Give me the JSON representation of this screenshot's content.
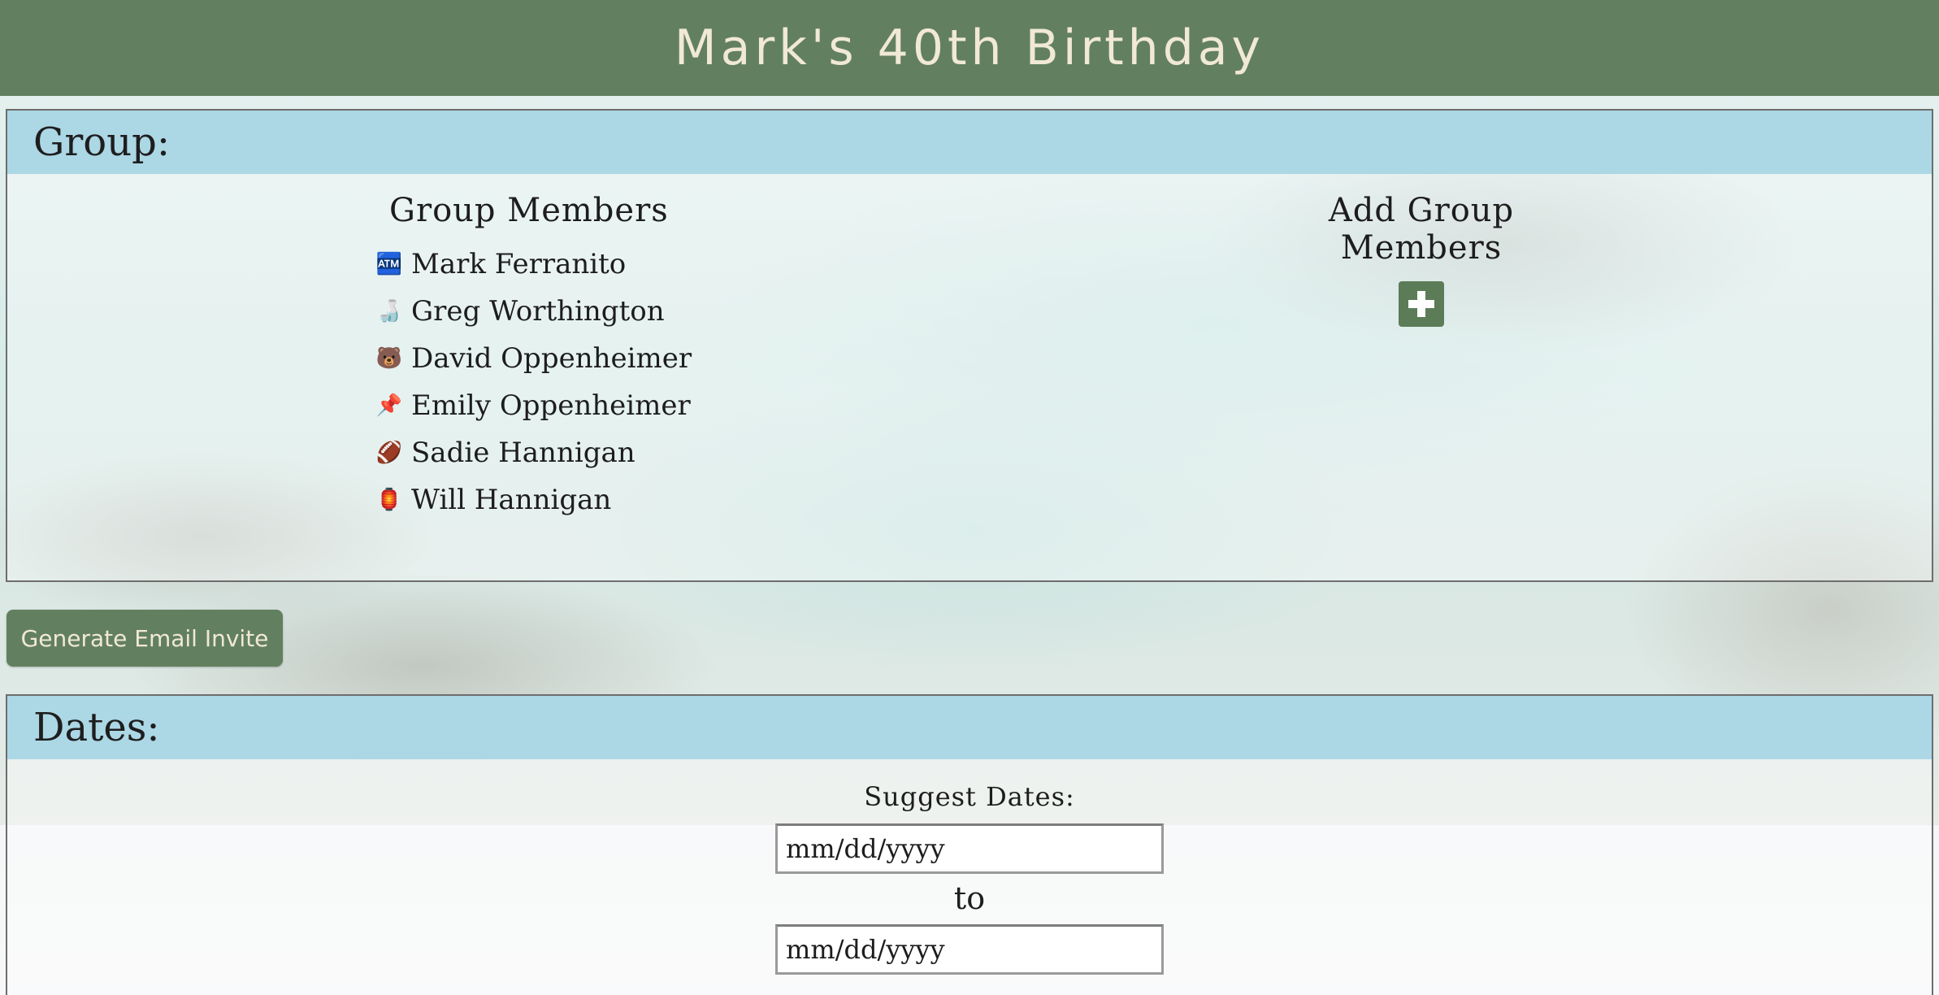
{
  "header": {
    "title": "Mark's 40th Birthday"
  },
  "group_section": {
    "title": "Group:",
    "members_heading": "Group Members",
    "members": [
      {
        "icon": "🏧",
        "icon_name": "atm-icon",
        "name": "Mark Ferranito"
      },
      {
        "icon": "🍶",
        "icon_name": "sake-bottle-icon",
        "name": "Greg Worthington"
      },
      {
        "icon": "🐻",
        "icon_name": "bear-icon",
        "name": "David Oppenheimer"
      },
      {
        "icon": "📌",
        "icon_name": "pushpin-icon",
        "name": "Emily Oppenheimer"
      },
      {
        "icon": "🏈",
        "icon_name": "football-icon",
        "name": "Sadie Hannigan"
      },
      {
        "icon": "🏮",
        "icon_name": "lantern-icon",
        "name": "Will Hannigan"
      }
    ],
    "add_heading": "Add Group Members",
    "add_icon": "plus-icon"
  },
  "email_button": {
    "label": "Generate Email Invite"
  },
  "dates_section": {
    "title": "Dates:",
    "suggest_label": "Suggest Dates:",
    "start_placeholder": "mm/dd/yyyy",
    "to_label": "to",
    "end_placeholder": "mm/dd/yyyy"
  },
  "colors": {
    "header_bg": "#62805f",
    "header_text": "#f1e8d6",
    "section_header_bg": "#acd7e5",
    "button_bg": "#5b7c57"
  }
}
